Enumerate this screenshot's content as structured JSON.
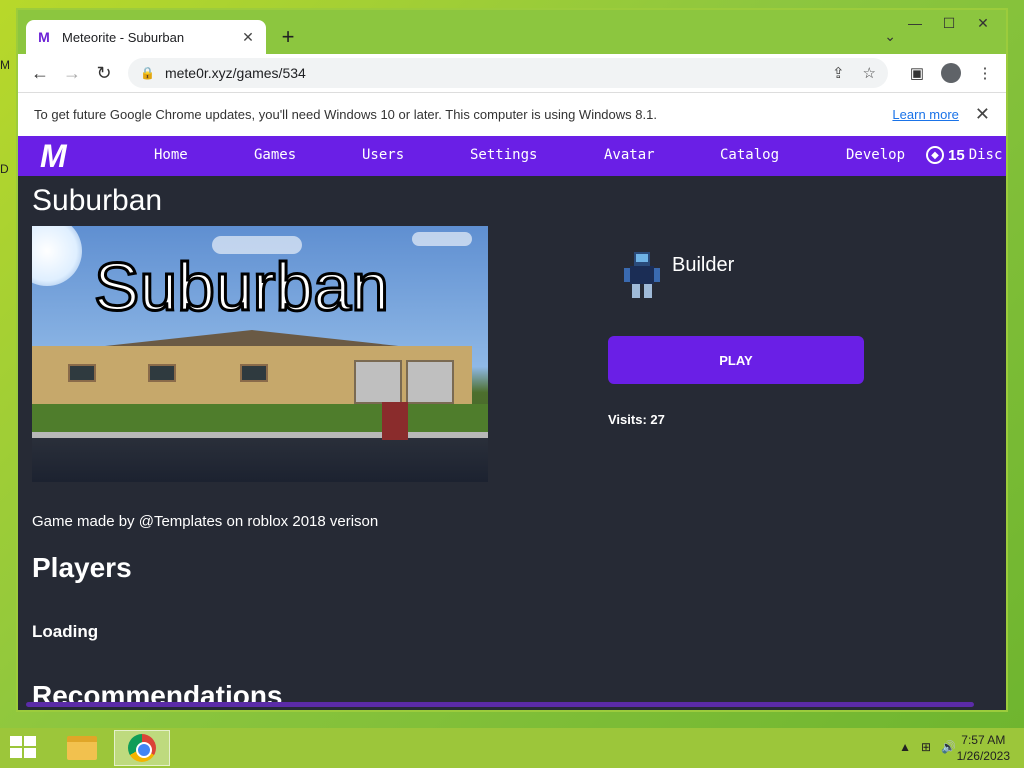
{
  "desktop": {
    "icon_m": "M",
    "icon_d": "D"
  },
  "window": {
    "minimize": "—",
    "maximize": "☐",
    "close": "✕"
  },
  "tab": {
    "title": "Meteorite - Suburban",
    "favicon": "M",
    "close": "✕",
    "new_tab": "+",
    "dropdown": "⌄"
  },
  "toolbar": {
    "back": "←",
    "forward": "→",
    "reload": "↻",
    "url": "mete0r.xyz/games/534",
    "share_icon": "share-icon",
    "star_icon": "star-icon",
    "sidepanel_icon": "side-panel-icon",
    "profile_icon": "profile-icon",
    "menu": "⋮"
  },
  "infobar": {
    "text": "To get future Google Chrome updates, you'll need Windows 10 or later. This computer is using Windows 8.1.",
    "link": "Learn more",
    "close": "✕"
  },
  "site": {
    "logo": "M",
    "nav": [
      "Home",
      "Games",
      "Users",
      "Settings",
      "Avatar",
      "Catalog",
      "Develop"
    ],
    "coins": "15",
    "disc": "Disc"
  },
  "game": {
    "title": "Suburban",
    "thumbnail_text": "Suburban",
    "creator": "Builder",
    "play": "PLAY",
    "visits": "Visits: 27",
    "description": "Game made by @Templates on roblox 2018 verison",
    "players_heading": "Players",
    "loading": "Loading",
    "recommendations_heading": "Recommendations"
  },
  "taskbar": {
    "clock_time": "7:57 AM",
    "clock_date": "1/26/2023",
    "tray_up": "▲",
    "tray_network": "⊞",
    "tray_volume": "🔊"
  },
  "colors": {
    "brand_purple": "#6a1fe6",
    "page_bg": "#262a35",
    "desktop_green": "#8cc63f"
  }
}
